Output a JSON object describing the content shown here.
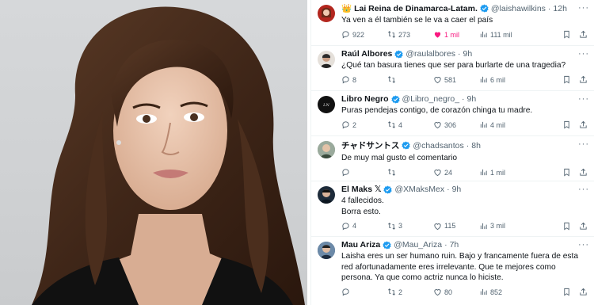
{
  "tweets": [
    {
      "crown": "👑",
      "name": "Lai Reina de Dinamarca-Latam.",
      "handle": "@laishawilkins",
      "time": "12h",
      "text": "Ya ven a él también se le va a caer el país",
      "replies": "922",
      "retweets": "273",
      "likes": "1 mil",
      "views": "111 mil",
      "liked": true,
      "avatar_color": "#b3261e"
    },
    {
      "name": "Raúl Albores",
      "handle": "@raulalbores",
      "time": "9h",
      "text": "¿Qué tan basura tienes que ser para burlarte de una tragedia?",
      "replies": "8",
      "retweets": "",
      "likes": "581",
      "views": "6 mil",
      "liked": false,
      "avatar_color": "#2b2b2b"
    },
    {
      "name": "Libro Negro",
      "handle": "@Libro_negro_",
      "time": "9h",
      "text": "Puras pendejas contigo, de corazón chinga tu madre.",
      "replies": "2",
      "retweets": "4",
      "likes": "306",
      "views": "4 mil",
      "liked": false,
      "avatar_color": "#111111",
      "avatar_text": "Libro Negro"
    },
    {
      "name": "チャドサントス",
      "handle": "@chadsantos",
      "time": "8h",
      "text": "De muy mal gusto el comentario",
      "replies": "",
      "retweets": "",
      "likes": "24",
      "views": "1 mil",
      "liked": false,
      "avatar_color": "#8a9a8c"
    },
    {
      "name": "El Maks 𝕏",
      "handle": "@XMaksMex",
      "time": "9h",
      "text": "4 fallecidos.\nBorra esto.",
      "replies": "4",
      "retweets": "3",
      "likes": "115",
      "views": "3 mil",
      "liked": false,
      "avatar_color": "#1d2b3a"
    },
    {
      "name": "Mau Ariza",
      "handle": "@Mau_Ariza",
      "time": "7h",
      "text": "Laisha eres un ser humano ruin. Bajo y francamente fuera de esta red afortunadamente eres irrelevante. Que te mejores como persona. Ya que como actriz nunca lo hiciste.",
      "replies": "",
      "retweets": "2",
      "likes": "80",
      "views": "852",
      "liked": false,
      "avatar_color": "#3d5a7a"
    }
  ],
  "colors": {
    "verified": "#1d9bf0",
    "like_active": "#f91880",
    "muted": "#536471"
  },
  "icons": [
    "reply-icon",
    "retweet-icon",
    "like-icon",
    "views-icon",
    "bookmark-icon",
    "share-icon",
    "verified-icon",
    "more-icon"
  ]
}
